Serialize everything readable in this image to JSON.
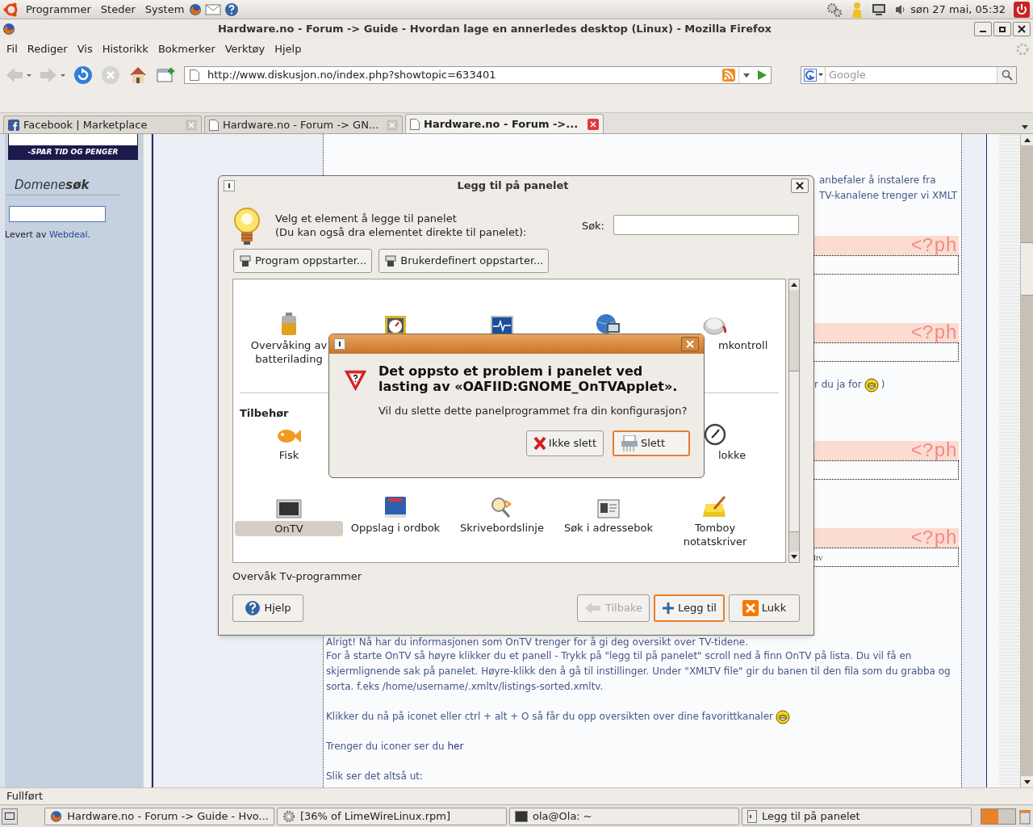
{
  "top_panel": {
    "menus": [
      "Programmer",
      "Steder",
      "System"
    ],
    "clock": "søn 27 mai, 05:32"
  },
  "window": {
    "title": "Hardware.no - Forum -> Guide - Hvordan lage en annerledes desktop (Linux) - Mozilla Firefox"
  },
  "menu_bar": [
    "Fil",
    "Rediger",
    "Vis",
    "Historikk",
    "Bokmerker",
    "Verktøy",
    "Hjelp"
  ],
  "toolbar": [
    {
      "kind": "back",
      "disabled": true
    },
    {
      "kind": "forward",
      "disabled": true
    },
    {
      "kind": "reload",
      "disabled": false
    },
    {
      "kind": "stop",
      "disabled": true
    },
    {
      "kind": "home",
      "disabled": false
    },
    {
      "kind": "newtab",
      "disabled": false
    }
  ],
  "url": "http://www.diskusjon.no/index.php?showtopic=633401",
  "search": {
    "placeholder": "Google"
  },
  "tabs": [
    {
      "label": "Facebook | Marketplace",
      "selected": false
    },
    {
      "label": "Hardware.no - Forum -> GN...",
      "selected": false
    },
    {
      "label": "Hardware.no - Forum ->...",
      "selected": true
    }
  ],
  "sidebar": {
    "banner": "-SPAR TID OG PENGER",
    "heading": "Domene**søk**",
    "credit": "Levert av ",
    "credit_link": "Webdeal",
    "credit_end": "."
  },
  "post": {
    "intro": [
      "anbefaler å instalere fra",
      "TV-kanalene trenger vi XMLT"
    ],
    "code_blocks": [
      {
        "label": "<?ph"
      },
      {
        "label": "<?ph"
      },
      {
        "label": "<?ph"
      },
      {
        "label": "<?ph",
        "code": "ltv"
      }
    ],
    "fragment": {
      "text": "r du ja for",
      "smiley": true,
      "end": ")"
    },
    "paragraphs": [
      {
        "text": "Alrigt! Nå har du informasjonen som OnTV trenger for å gi deg oversikt over TV-tidene.",
        "smiley": false
      },
      {
        "text": "For å starte OnTV så høyre klikker du et panell - Trykk på \"legg til på panelet\" scroll ned å finn OnTV på lista. Du vil få en skjermlignende sak på panelet. Høyre-klikk den å gå til instillinger. Under \"XMLTV file\" gir du banen til den fila som du grabba og sorta. f.eks /home/username/.xmltv/listings-sorted.xmltv.",
        "smiley": false
      },
      {
        "text": "Klikker du nå på iconet eller ctrl + alt + O så får du opp oversikten over dine favorittkanaler",
        "smiley": true
      },
      {
        "text": "Trenger du iconer ser du ",
        "link": "her",
        "smiley": false
      },
      {
        "text": "Slik ser det altså ut:",
        "smiley": false
      }
    ]
  },
  "add_dialog": {
    "title": "Legg til på panelet",
    "intro": [
      "Velg et element å legge til panelet",
      "(Du kan også dra elementet direkte til panelet):"
    ],
    "search_label": "Søk:",
    "launchers": [
      "Program oppstarter...",
      "Brukerdefinert oppstarter..."
    ],
    "sections": [
      {
        "rows": [
          {
            "items": [
              {
                "kind": "applet",
                "label": "Overvåking av batterilading",
                "selected": false
              },
              {
                "kind": "icon"
              },
              {
                "kind": "icon"
              },
              {
                "kind": "icon"
              },
              {
                "kind": "applet",
                "label": "mkontroll",
                "selected": false
              }
            ]
          }
        ]
      },
      {
        "heading": "Tilbehør",
        "rows": [
          {
            "items": [
              {
                "kind": "applet",
                "label": "Fisk",
                "selected": false
              },
              {
                "kind": "applet",
                "label": "lokke",
                "selected": false
              }
            ]
          },
          {
            "items": [
              {
                "kind": "applet",
                "label": "OnTV",
                "selected": true
              },
              {
                "kind": "applet",
                "label": "Oppslag i ordbok",
                "selected": false
              },
              {
                "kind": "applet",
                "label": "Skrivebordslinje",
                "selected": false
              },
              {
                "kind": "applet",
                "label": "Søk i adressebok",
                "selected": false
              },
              {
                "kind": "applet",
                "label": "Tomboy notatskriver",
                "selected": false
              }
            ]
          }
        ]
      }
    ],
    "description": "Overvåk Tv-programmer",
    "buttons": [
      {
        "kind": "help",
        "label": "Hjelp",
        "disabled": false,
        "default": false
      },
      {
        "kind": "back",
        "label": "Tilbake",
        "disabled": true,
        "default": false
      },
      {
        "kind": "add",
        "label": "Legg til",
        "disabled": false,
        "default": true
      },
      {
        "kind": "close",
        "label": "Lukk",
        "disabled": false,
        "default": false
      }
    ]
  },
  "error_dialog": {
    "message": "Det oppsto et problem i panelet ved lasting av «OAFIID:GNOME_OnTVApplet».",
    "question": "Vil du slette dette panelprogrammet fra din konfigurasjon?",
    "buttons": [
      {
        "kind": "cancel",
        "label": "Ikke slett",
        "default": false
      },
      {
        "kind": "delete",
        "label": "Slett",
        "default": true
      }
    ]
  },
  "status_bar": "Fullført",
  "taskbar": [
    {
      "kind": "browser",
      "label": "Hardware.no - Forum -> Guide - Hvo..."
    },
    {
      "kind": "download",
      "label": "[36% of LimeWireLinux.rpm]"
    },
    {
      "kind": "terminal",
      "label": "ola@Ola: ~"
    },
    {
      "kind": "window",
      "label": "Legg til på panelet"
    }
  ]
}
